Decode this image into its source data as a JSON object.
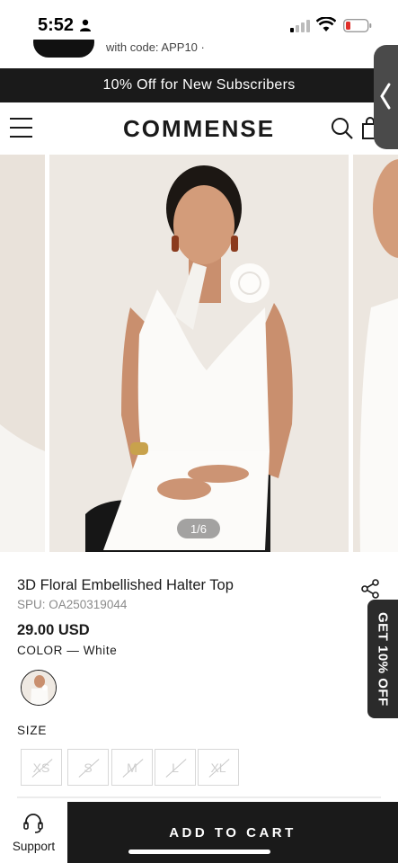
{
  "status_bar": {
    "time": "5:52"
  },
  "promo": {
    "peek_text": "with code: APP10 ·"
  },
  "announcement": {
    "text": "10% Off for New Subscribers"
  },
  "header": {
    "logo": "COMMENSE"
  },
  "gallery": {
    "counter": "1/6"
  },
  "product": {
    "title": "3D Floral Embellished Halter Top",
    "spu": "SPU: OA250319044",
    "price": "29.00 USD",
    "color_label": "COLOR — White",
    "size_label": "SIZE",
    "sizes": [
      "XS",
      "S",
      "M",
      "L",
      "XL"
    ]
  },
  "offer_tab": {
    "text": "GET 10% OFF"
  },
  "bottom_bar": {
    "support_label": "Support",
    "add_to_cart": "ADD TO CART"
  },
  "colors": {
    "dark": "#1a1a1a",
    "photo_bg": "#ede8e2",
    "side_tab": "#4a4a4a"
  }
}
